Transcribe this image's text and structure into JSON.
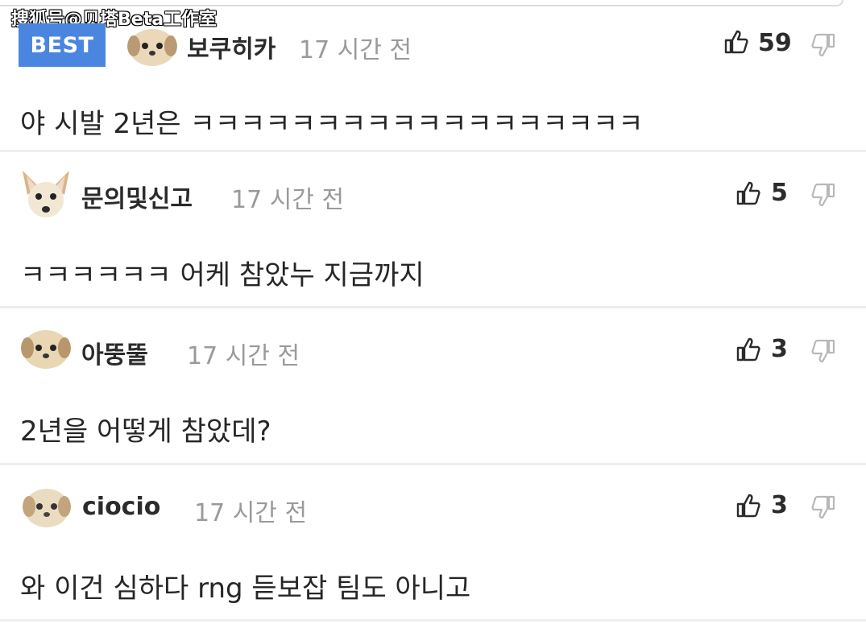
{
  "watermark": "搜狐号@贝塔Beta工作室",
  "comments": [
    {
      "badge": "BEST",
      "username": "보쿠히카",
      "time": "17 시간 전",
      "likes": "59",
      "text": "야 시발 2년은 ㅋㅋㅋㅋㅋㅋㅋㅋㅋㅋㅋㅋㅋㅋㅋㅋㅋㅋ",
      "avatar_icon": "puppy-face-icon"
    },
    {
      "username": "문의및신고",
      "time": "17 시간 전",
      "likes": "5",
      "text": "ㅋㅋㅋㅋㅋㅋ 어케 참았누 지금까지",
      "avatar_icon": "chihuahua-face-icon"
    },
    {
      "username": "아뚱뚤",
      "time": "17 시간 전",
      "likes": "3",
      "text": "2년을 어떻게 참았데?",
      "avatar_icon": "puppy-face-icon"
    },
    {
      "username": "ciocio",
      "time": "17 시간 전",
      "likes": "3",
      "text": "와 이건 심하다 rng 듣보잡 팀도 아니고",
      "avatar_icon": "puppy-face-icon"
    }
  ],
  "colors": {
    "best_badge": "#4a86e0",
    "time_text": "#9a9a9a",
    "divider": "#eeeeee"
  }
}
